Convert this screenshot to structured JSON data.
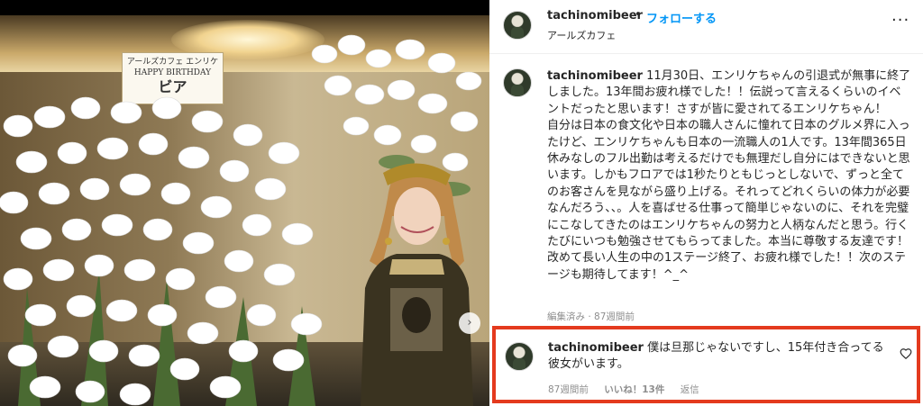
{
  "photo": {
    "sign_line1": "アールズカフェ エンリケ",
    "sign_big": "ビア",
    "sign_line2": "HAPPY BIRTHDAY",
    "next_icon": "chevron-right-icon",
    "next_glyph": "›"
  },
  "post": {
    "username": "tachinomibeer",
    "separator": "•",
    "follow_label": "フォローする",
    "location": "アールズカフェ",
    "more_icon": "more-horizontal-icon",
    "more_glyph": "···"
  },
  "caption": {
    "username": "tachinomibeer",
    "text": " 11月30日、エンリケちゃんの引退式が無事に終了しました。13年間お疲れ様でした！！伝説って言えるくらいのイベントだったと思います！さすが皆に愛されてるエンリケちゃん！\n自分は日本の食文化や日本の職人さんに憧れて日本のグルメ界に入ったけど、エンリケちゃんも日本の一流職人の1人です。13年間365日休みなしのフル出勤は考えるだけでも無理だし自分にはできないと思います。しかもフロアでは1秒たりともじっとしないで、ずっと全てのお客さんを見ながら盛り上げる。それってどれくらいの体力が必要なんだろう、、。人を喜ばせる仕事って簡単じゃないのに、それを完璧にこなしてきたのはエンリケちゃんの努力と人柄なんだと思う。行くたびにいつも勉強させてもらってました。本当に尊敬する友達です！\n改めて長い人生の中の1ステージ終了、お疲れ様でした！！次のステージも期待してます！^_^",
    "meta": "編集済み · 87週間前"
  },
  "reply": {
    "username": "tachinomibeer",
    "text": " 僕は旦那じゃないですし、15年付き合ってる彼女がいます。",
    "time": "87週間前",
    "likes": "いいね！13件",
    "reply_label": "返信",
    "heart_icon": "heart-outline-icon"
  },
  "colors": {
    "follow": "#0095f6",
    "highlight_border": "#e43a1e",
    "meta_text": "#8e8e8e"
  }
}
